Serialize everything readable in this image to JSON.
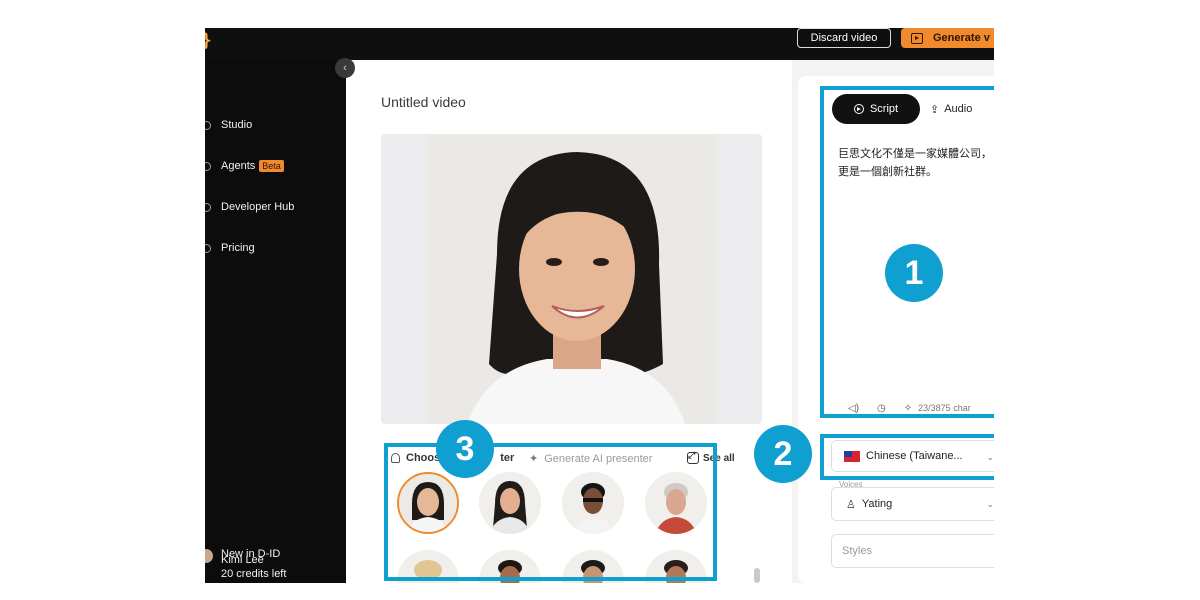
{
  "topbar": {
    "logo": "}",
    "discard_label": "Discard video",
    "generate_label": "Generate v"
  },
  "sidebar": {
    "items": [
      {
        "label": "Studio",
        "icon": "studio-icon"
      },
      {
        "label": "Agents",
        "icon": "agents-icon",
        "badge": "Beta"
      },
      {
        "label": "Developer Hub",
        "icon": "developer-hub-icon"
      },
      {
        "label": "Pricing",
        "icon": "pricing-icon"
      }
    ],
    "new_label": "New in D-ID",
    "user_name": "Kimi Lee",
    "credits": "20 credits left",
    "collapse_glyph": "‹"
  },
  "main": {
    "title": "Untitled video",
    "presenter_tabs": {
      "choose_label": "Choos",
      "choose_label_tail": "ter",
      "generate_label": "Generate AI presenter",
      "see_all_label": "See all"
    }
  },
  "right_panel": {
    "tabs": {
      "script_label": "Script",
      "audio_label": "Audio"
    },
    "script_lines": [
      "巨思文化不僅是一家媒體公司，",
      "更是一個創新社群。"
    ],
    "char_count": "23/3875 char",
    "language_value": "Chinese (Taiwane...",
    "voices_label": "Voices",
    "voice_value": "Yating",
    "styles_placeholder": "Styles"
  },
  "callouts": [
    "1",
    "2",
    "3"
  ],
  "colors": {
    "accent_orange": "#f08a2c",
    "callout_blue": "#0f9fd1",
    "sidebar_bg": "#0c0c0c"
  }
}
